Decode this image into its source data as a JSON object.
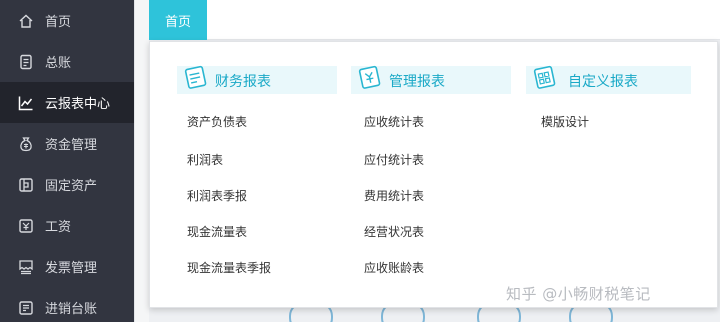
{
  "sidebar": {
    "items": [
      {
        "label": "首页",
        "icon": "home-icon"
      },
      {
        "label": "总账",
        "icon": "ledger-icon"
      },
      {
        "label": "云报表中心",
        "icon": "chart-icon",
        "active": true
      },
      {
        "label": "资金管理",
        "icon": "money-bag-icon"
      },
      {
        "label": "固定资产",
        "icon": "asset-icon"
      },
      {
        "label": "工资",
        "icon": "payroll-icon"
      },
      {
        "label": "发票管理",
        "icon": "invoice-icon"
      },
      {
        "label": "进销台账",
        "icon": "inventory-icon"
      }
    ]
  },
  "topbar": {
    "home_tab": "首页"
  },
  "menu": {
    "categories": [
      {
        "title": "财务报表",
        "icon": "financial-report-icon",
        "items": [
          "资产负债表",
          "利润表",
          "利润表季报",
          "现金流量表",
          "现金流量表季报"
        ]
      },
      {
        "title": "管理报表",
        "icon": "management-report-icon",
        "items": [
          "应收统计表",
          "应付统计表",
          "费用统计表",
          "经营状况表",
          "应收账龄表"
        ]
      },
      {
        "title": "自定义报表",
        "icon": "custom-report-icon",
        "items": [
          "模版设计"
        ]
      }
    ]
  },
  "watermark": "知乎 @小畅财税笔记",
  "colors": {
    "sidebar_bg": "#323540",
    "sidebar_active_bg": "#22242c",
    "accent": "#2ec3da",
    "category_text": "#1aa9c7",
    "category_bar_bg": "#e9f8fb"
  }
}
